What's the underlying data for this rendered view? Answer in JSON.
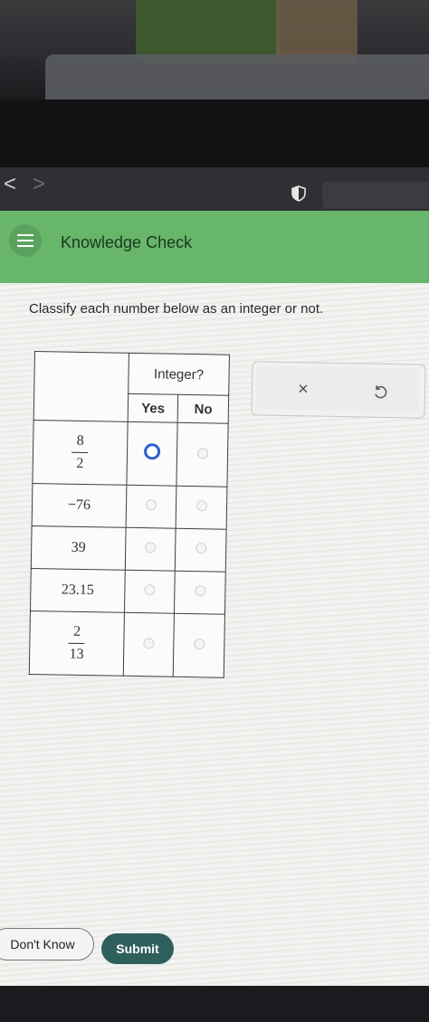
{
  "header": {
    "title": "Knowledge Check"
  },
  "question": {
    "text": "Classify each number below as an integer or not."
  },
  "table": {
    "group_header": "Integer?",
    "col_yes": "Yes",
    "col_no": "No",
    "rows": [
      {
        "numerator": "8",
        "denominator": "2",
        "value": "",
        "selected": "yes"
      },
      {
        "value": "−76",
        "selected": ""
      },
      {
        "value": "39",
        "selected": ""
      },
      {
        "value": "23.15",
        "selected": ""
      },
      {
        "numerator": "2",
        "denominator": "13",
        "value": "",
        "selected": ""
      }
    ]
  },
  "actions": {
    "clear_label": "×"
  },
  "nav": {
    "back": "<",
    "forward": ">"
  },
  "footer": {
    "dont_know": "Don't Know",
    "submit": "Submit"
  },
  "colors": {
    "header_green": "#68b56c",
    "submit_teal": "#2f5f5c",
    "radio_selected": "#2f5fd0"
  },
  "icons": {
    "menu": "hamburger-icon",
    "undo": "undo-icon",
    "clear": "close-icon",
    "shield": "shield-icon"
  }
}
